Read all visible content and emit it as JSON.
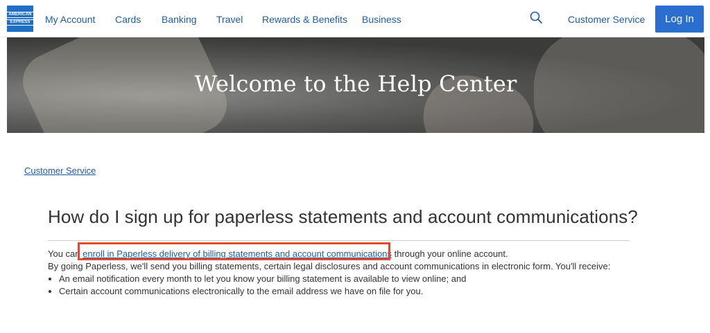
{
  "header": {
    "logo_line1": "AMERICAN",
    "logo_line2": "EXPRESS",
    "nav": [
      "My Account",
      "Cards",
      "Banking",
      "Travel",
      "Rewards & Benefits",
      "Business"
    ],
    "customer_service": "Customer Service",
    "login": "Log In",
    "search_icon": "search-icon"
  },
  "hero": {
    "title": "Welcome to the Help Center"
  },
  "breadcrumb": "Customer Service",
  "article": {
    "question": "How do I sign up for paperless statements and account communications?",
    "line1_prefix": "You can ",
    "line1_link": "enroll in Paperless delivery of billing statements and account communications",
    "line1_suffix": " through your online account.",
    "line2": "By going Paperless, we'll send you billing statements, certain legal disclosures and account communications in electronic form. You'll receive:",
    "bullets": [
      "An email notification every month to let you know your billing statement is available to view online; and",
      "Certain account communications electronically to the email address we have on file for you."
    ]
  },
  "colors": {
    "brand_blue": "#1f6fc5",
    "link_blue": "#1f5ca8",
    "button_blue": "#2a6ed0",
    "highlight_red": "#e04a2f"
  }
}
